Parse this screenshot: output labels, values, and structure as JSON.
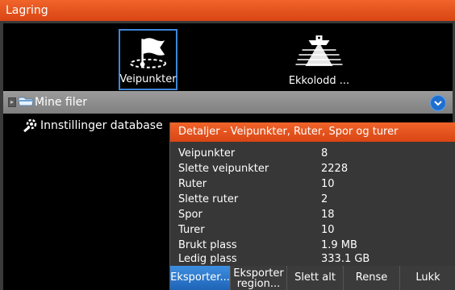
{
  "window": {
    "title": "Lagring"
  },
  "toolbar": {
    "items": [
      {
        "label": "Veipunkter",
        "icon": "waypoint-flag-icon",
        "selected": true
      },
      {
        "label": "Ekkolodd ...",
        "icon": "echosounder-icon",
        "selected": false
      }
    ]
  },
  "tree": {
    "root_label": "Mine filer",
    "root_icon": "folder-icon",
    "database_label": "Innstillinger database",
    "database_icon": "database-settings-icon"
  },
  "details": {
    "title": "Detaljer - Veipunkter, Ruter, Spor og turer",
    "rows": [
      {
        "key": "Veipunkter",
        "value": "8"
      },
      {
        "key": "Slette veipunkter",
        "value": "2228"
      },
      {
        "key": "Ruter",
        "value": "10"
      },
      {
        "key": "Slette ruter",
        "value": "2"
      },
      {
        "key": "Spor",
        "value": "18"
      },
      {
        "key": "Turer",
        "value": "10"
      },
      {
        "key": "Brukt plass",
        "value": "1.9 MB"
      },
      {
        "key": "Ledig plass",
        "value": "333.1 GB"
      }
    ],
    "buttons": [
      "Eksporter...",
      "Eksporter region...",
      "Slett alt",
      "Rense",
      "Lukk"
    ]
  },
  "colors": {
    "accent": "#e8541e",
    "select": "#2f7fd6"
  }
}
